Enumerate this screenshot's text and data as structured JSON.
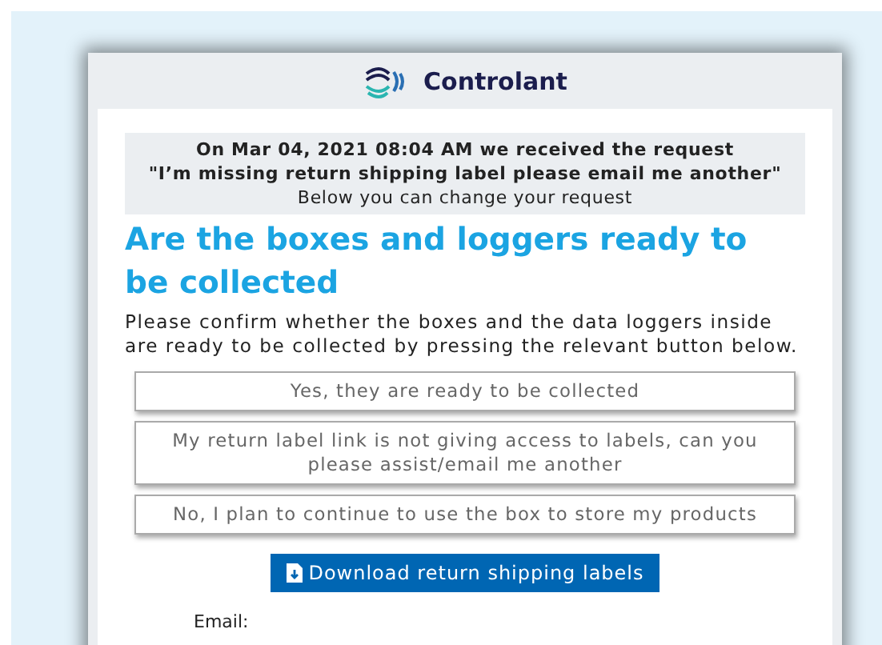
{
  "brand": {
    "name": "Controlant"
  },
  "notice": {
    "lines": [
      "On Mar 04, 2021 08:04 AM we received the request",
      "\"I’m missing return shipping label please email me another\"",
      "Below you can change your request"
    ]
  },
  "heading": "Are the boxes and loggers ready to be collected",
  "description": "Please confirm whether the boxes and the data loggers inside are ready to be collected by pressing the relevant button below.",
  "options": [
    {
      "label": "Yes, they are ready to be collected"
    },
    {
      "label": "My return label link is not giving access to labels, can you please assist/email me another"
    },
    {
      "label": "No, I plan to continue to use the box to store my products"
    }
  ],
  "download_button": {
    "label": "Download return shipping labels"
  },
  "email_label": "Email:"
}
